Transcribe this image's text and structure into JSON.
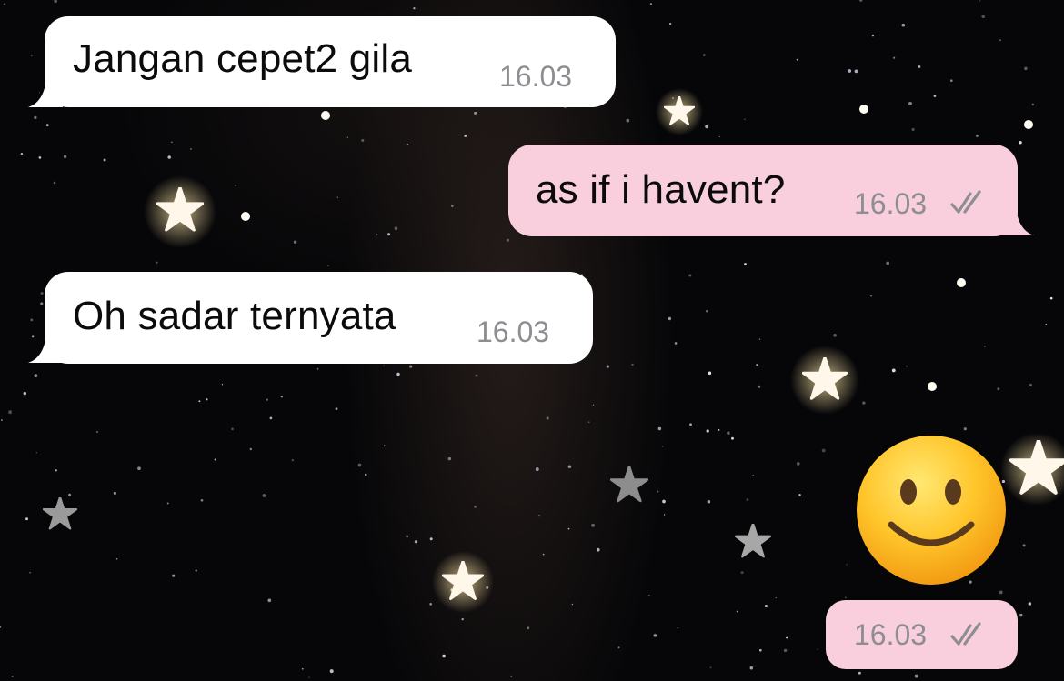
{
  "chat": {
    "messages": [
      {
        "direction": "incoming",
        "text": "Jangan cepet2 gila",
        "time": "16.03"
      },
      {
        "direction": "outgoing",
        "text": "as if i havent?",
        "time": "16.03",
        "status": "read"
      },
      {
        "direction": "incoming",
        "text": "Oh sadar ternyata",
        "time": "16.03"
      },
      {
        "direction": "outgoing",
        "emoji": "slightly-smiling-face",
        "time": "16.03",
        "status": "read"
      }
    ],
    "colors": {
      "incoming_bubble": "#ffffff",
      "outgoing_bubble": "#f9cfdd",
      "timestamp": "#8d8d92",
      "read_check": "#8d8d92",
      "wallpaper": "#060608"
    },
    "wallpaper": "starry-night-with-glowing-stars"
  }
}
